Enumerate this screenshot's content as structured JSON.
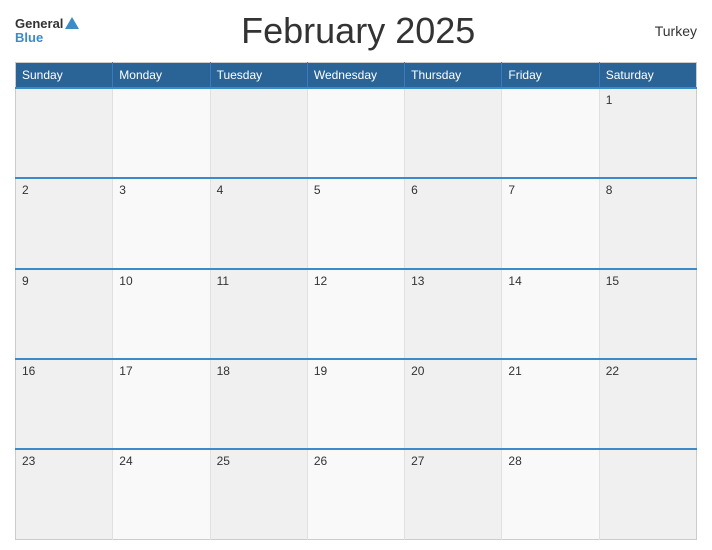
{
  "header": {
    "title": "February 2025",
    "country": "Turkey",
    "logo_general": "General",
    "logo_blue": "Blue"
  },
  "days_of_week": [
    "Sunday",
    "Monday",
    "Tuesday",
    "Wednesday",
    "Thursday",
    "Friday",
    "Saturday"
  ],
  "weeks": [
    [
      "",
      "",
      "",
      "",
      "",
      "",
      "1"
    ],
    [
      "2",
      "3",
      "4",
      "5",
      "6",
      "7",
      "8"
    ],
    [
      "9",
      "10",
      "11",
      "12",
      "13",
      "14",
      "15"
    ],
    [
      "16",
      "17",
      "18",
      "19",
      "20",
      "21",
      "22"
    ],
    [
      "23",
      "24",
      "25",
      "26",
      "27",
      "28",
      ""
    ]
  ]
}
